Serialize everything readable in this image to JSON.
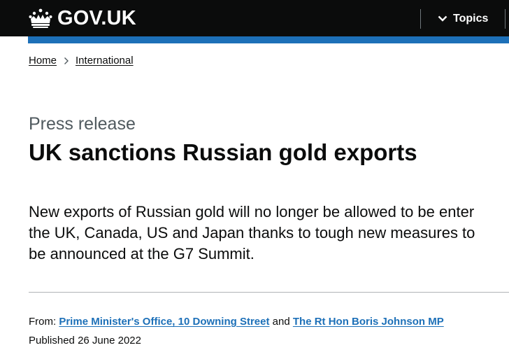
{
  "header": {
    "logo_text": "GOV.UK",
    "topics_label": "Topics",
    "colors": {
      "background": "#0b0c0c",
      "accent_bar": "#1d70b8"
    }
  },
  "breadcrumb": {
    "items": [
      {
        "label": "Home"
      },
      {
        "label": "International"
      }
    ]
  },
  "article": {
    "caption": "Press release",
    "title": "UK sanctions Russian gold exports",
    "lead": "New exports of Russian gold will no longer be allowed to be enter the UK, Canada, US and Japan thanks to tough new measures to be announced at the G7 Summit."
  },
  "metadata": {
    "from_label": "From:",
    "from_links": [
      {
        "label": "Prime Minister's Office, 10 Downing Street"
      },
      {
        "label": "The Rt Hon Boris Johnson MP"
      }
    ],
    "and_text": "and",
    "published_label": "Published",
    "published_date": "26 June 2022"
  },
  "colors": {
    "link": "#1d70b8",
    "secondary_text": "#505a5f",
    "divider": "#b1b4b6"
  }
}
